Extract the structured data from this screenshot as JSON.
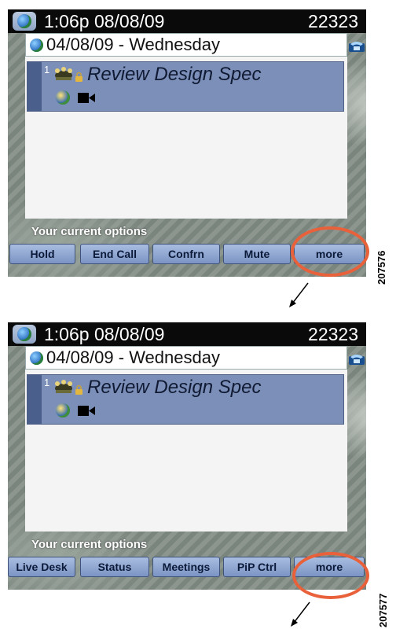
{
  "panels": [
    {
      "status_time": "1:06p 08/08/09",
      "extension": "22323",
      "date_line": "04/08/09 - Wednesday",
      "call_index": "1",
      "call_title": "Review Design Spec",
      "options_label": "Your current options",
      "softkeys": [
        "Hold",
        "End Call",
        "Confrn",
        "Mute",
        "more"
      ],
      "figure_id": "207576"
    },
    {
      "status_time": "1:06p 08/08/09",
      "extension": "22323",
      "date_line": "04/08/09 - Wednesday",
      "call_index": "1",
      "call_title": "Review Design Spec",
      "options_label": "Your current options",
      "softkeys": [
        "Live Desk",
        "Status",
        "Meetings",
        "PiP Ctrl",
        "more"
      ],
      "figure_id": "207577"
    }
  ],
  "colors": {
    "highlight_circle": "#e8613a",
    "softkey_fill": "#8ea6d2",
    "call_row": "#7b8fb8",
    "status_bar": "#0a0a0a"
  },
  "icons": [
    "globe-icon",
    "conference-icon",
    "lock-icon",
    "video-icon",
    "phone-icon",
    "arrow-icon"
  ]
}
